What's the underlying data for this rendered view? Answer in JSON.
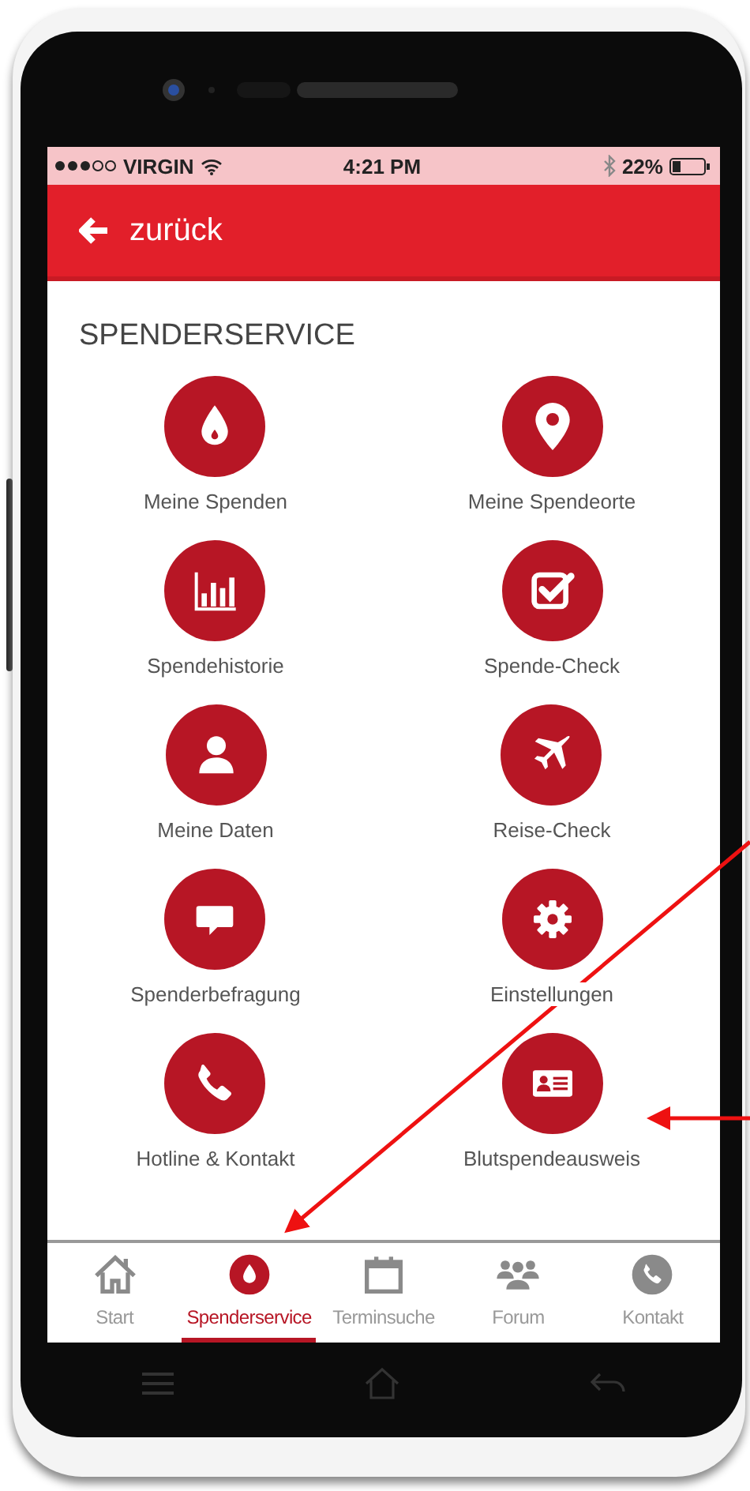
{
  "status_bar": {
    "carrier": "VIRGIN",
    "time": "4:21 PM",
    "battery": "22%"
  },
  "header": {
    "back_label": "zurück"
  },
  "section_title": "SPENDERSERVICE",
  "tiles": [
    {
      "label": "Meine Spenden"
    },
    {
      "label": "Meine Spendeorte"
    },
    {
      "label": "Spendehistorie"
    },
    {
      "label": "Spende-Check"
    },
    {
      "label": "Meine Daten"
    },
    {
      "label": "Reise-Check"
    },
    {
      "label": "Spenderbefragung"
    },
    {
      "label": "Einstellungen"
    },
    {
      "label": "Hotline & Kontakt"
    },
    {
      "label": "Blutspendeausweis"
    }
  ],
  "tabs": [
    {
      "label": "Start",
      "selected": false
    },
    {
      "label": "Spenderservice",
      "selected": true
    },
    {
      "label": "Terminsuche",
      "selected": false
    },
    {
      "label": "Forum",
      "selected": false
    },
    {
      "label": "Kontakt",
      "selected": false
    }
  ]
}
